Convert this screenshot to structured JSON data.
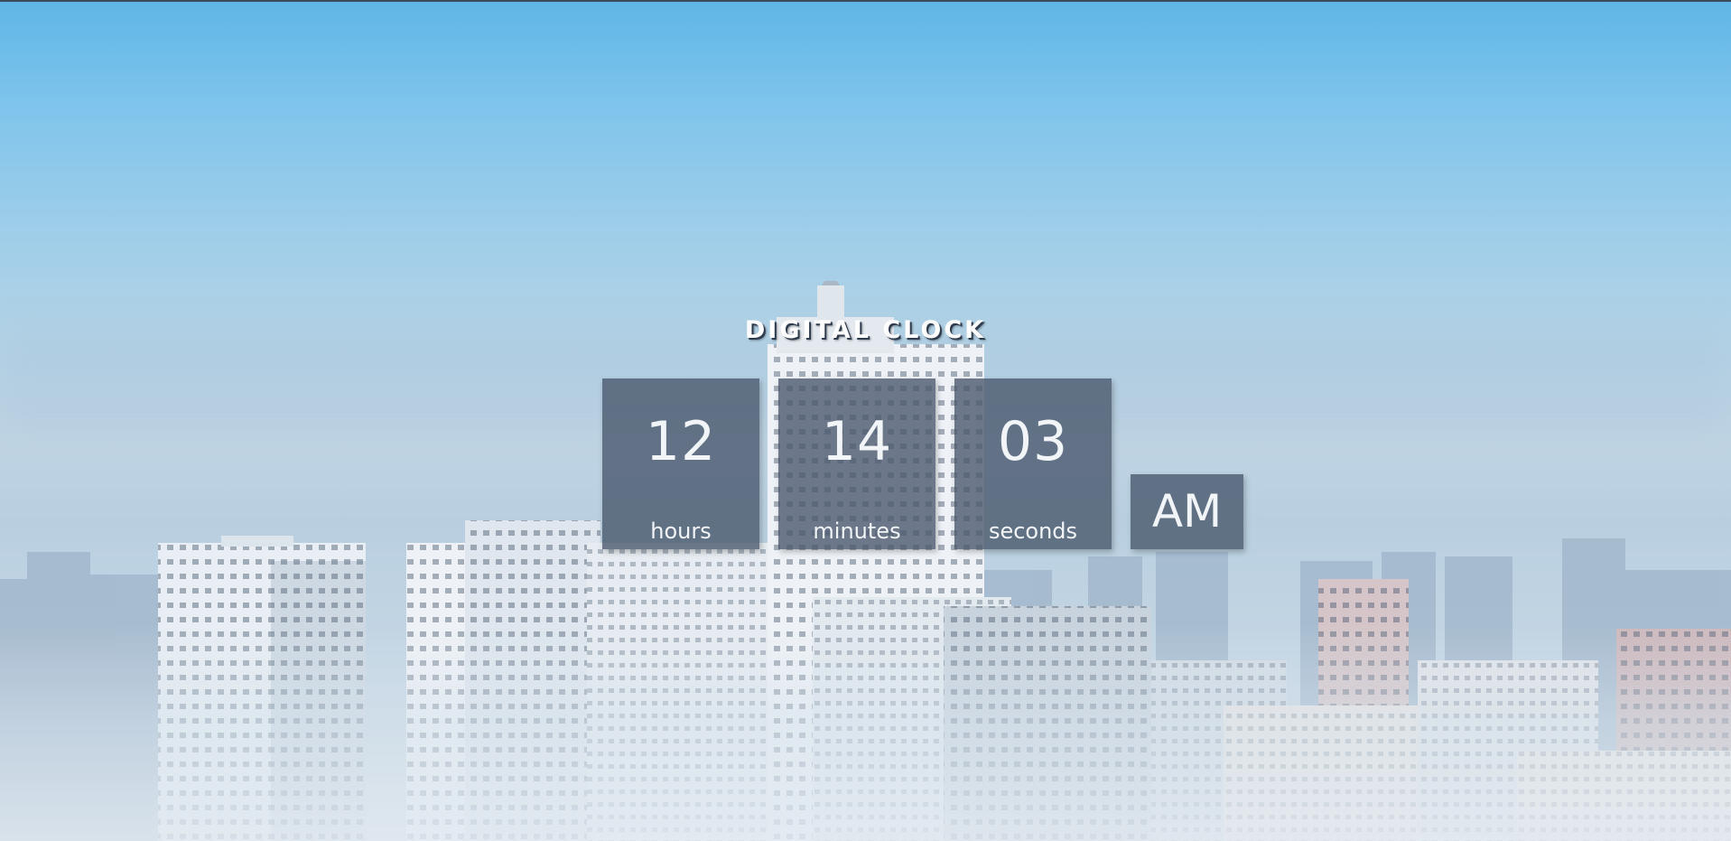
{
  "page": {
    "title": "DIGITAL CLOCK"
  },
  "clock": {
    "hours": {
      "value": "12",
      "label": "hours"
    },
    "minutes": {
      "value": "14",
      "label": "minutes"
    },
    "seconds": {
      "value": "03",
      "label": "seconds"
    },
    "period": "AM"
  },
  "colors": {
    "panel": "#48566a",
    "text": "#f2f5f8",
    "sky_top": "#5fb6e6"
  },
  "background": "foggy city skyline photo"
}
